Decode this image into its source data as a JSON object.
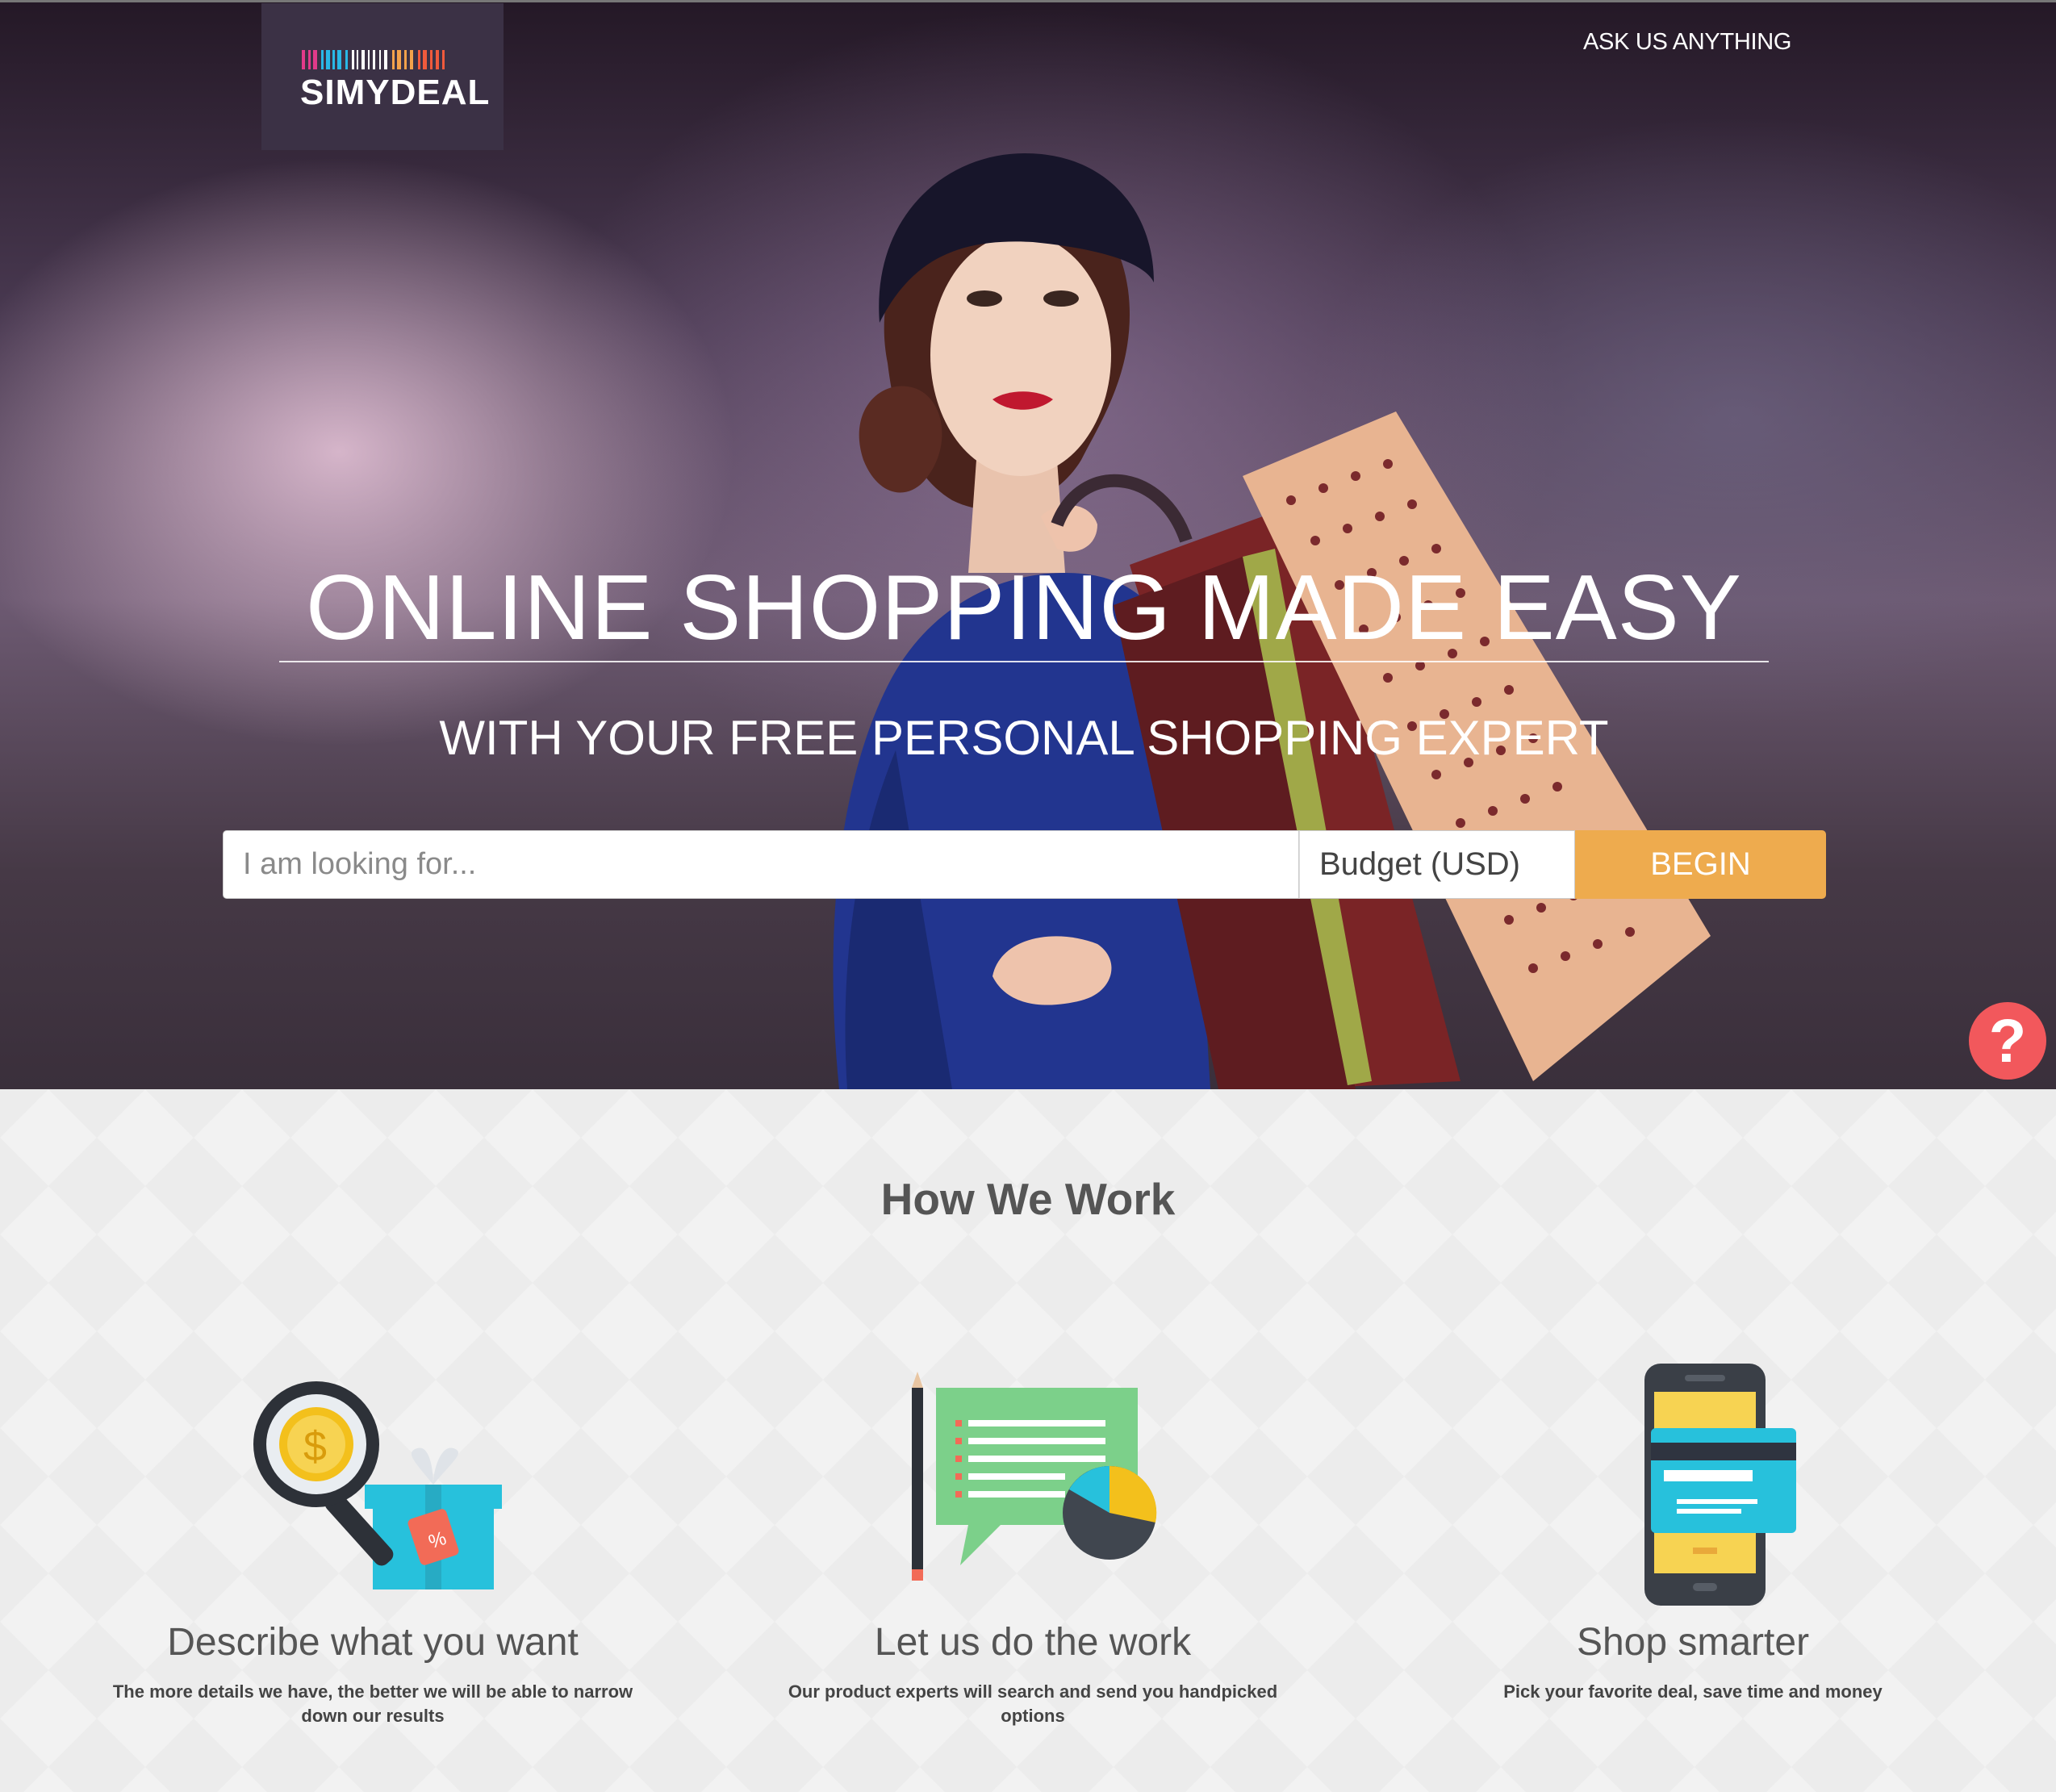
{
  "header": {
    "logo_text": "SIMYDEAL",
    "ask_link": "ASK US ANYTHING"
  },
  "hero": {
    "headline": "ONLINE SHOPPING MADE EASY",
    "subheadline": "WITH YOUR FREE PERSONAL SHOPPING EXPERT",
    "search_placeholder": "I am looking for...",
    "budget_placeholder": "Budget (USD)",
    "begin_label": "BEGIN",
    "help_label": "?"
  },
  "how_we_work": {
    "title": "How We Work",
    "steps": [
      {
        "title": "Describe what you want",
        "text": "The more details we have, the better we will be able to narrow down our results",
        "icon": "magnifier-gift-icon"
      },
      {
        "title": "Let us do the work",
        "text": "Our product experts will search and send you handpicked options",
        "icon": "chat-report-icon"
      },
      {
        "title": "Shop smarter",
        "text": "Pick your favorite deal, save time and money",
        "icon": "phone-card-icon"
      }
    ]
  },
  "colors": {
    "accent": "#eeab4e",
    "help": "#f2585c",
    "logo_bg": "#3b3145"
  }
}
